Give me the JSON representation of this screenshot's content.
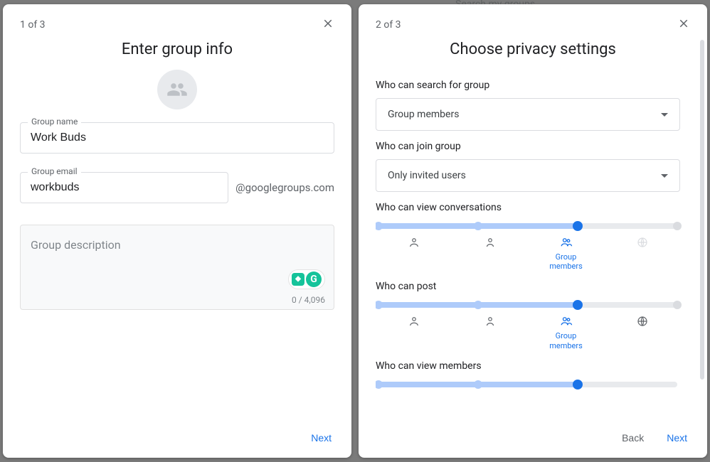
{
  "left": {
    "step": "1 of 3",
    "title": "Enter group info",
    "groupNameLabel": "Group name",
    "groupNameValue": "Work Buds",
    "groupEmailLabel": "Group email",
    "groupEmailValue": "workbuds",
    "emailSuffix": "@googlegroups.com",
    "descPlaceholder": "Group description",
    "descCounter": "0 / 4,096",
    "nextLabel": "Next"
  },
  "right": {
    "step": "2 of 3",
    "title": "Choose privacy settings",
    "searchLabel": "Who can search for group",
    "searchValue": "Group members",
    "joinLabel": "Who can join group",
    "joinValue": "Only invited users",
    "viewConvLabel": "Who can view conversations",
    "postLabel": "Who can post",
    "viewMembersLabel": "Who can view members",
    "stopGroupMembers": "Group\nmembers",
    "backLabel": "Back",
    "nextLabel": "Next"
  },
  "background": {
    "searchMyGroups": "Search my groups"
  },
  "sliderStops": {
    "positions": [
      0,
      33.3,
      66.6,
      100
    ]
  }
}
